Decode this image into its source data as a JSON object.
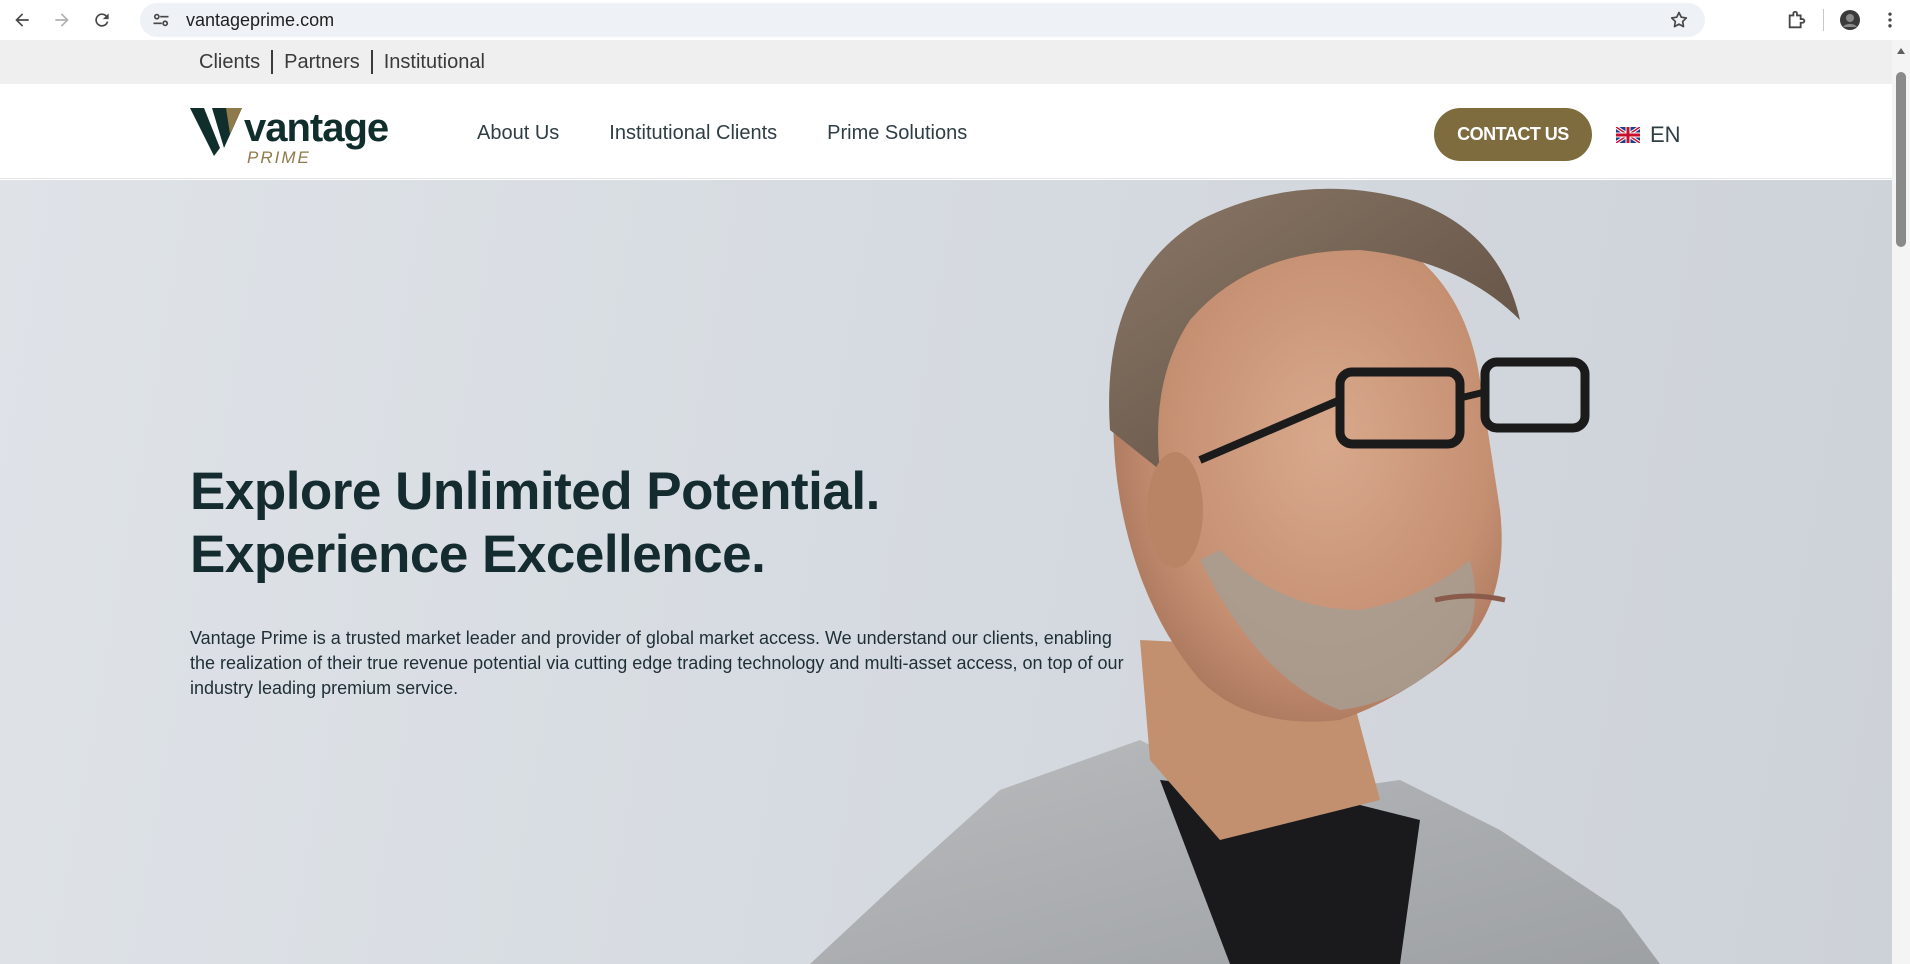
{
  "browser": {
    "url": "vantageprime.com",
    "icons": [
      "back-arrow-icon",
      "forward-arrow-icon",
      "reload-icon",
      "site-settings-icon",
      "bookmark-star-icon",
      "extensions-icon",
      "profile-icon",
      "more-vert-icon"
    ]
  },
  "topbar": {
    "links": [
      {
        "label": "Clients"
      },
      {
        "label": "Partners"
      },
      {
        "label": "Institutional"
      }
    ]
  },
  "header": {
    "logo": {
      "brand": "vantage",
      "sub": "PRIME"
    },
    "nav": [
      {
        "label": "About Us"
      },
      {
        "label": "Institutional Clients"
      },
      {
        "label": "Prime Solutions"
      }
    ],
    "contact_label": "CONTACT US",
    "language": "EN",
    "flag_icon": "uk-flag-icon"
  },
  "hero": {
    "title_line1": "Explore Unlimited Potential.",
    "title_line2": "Experience Excellence.",
    "description": "Vantage Prime is a trusted market leader and provider of global market access. We understand our clients, enabling the realization of their true revenue potential via cutting edge trading technology and multi-asset access, on top of our industry leading premium service."
  },
  "colors": {
    "accent": "#7e6c3f",
    "brand_dark": "#0f2e2c",
    "brand_gold": "#8e7a4a",
    "hero_bg": "#d6dbe1"
  }
}
